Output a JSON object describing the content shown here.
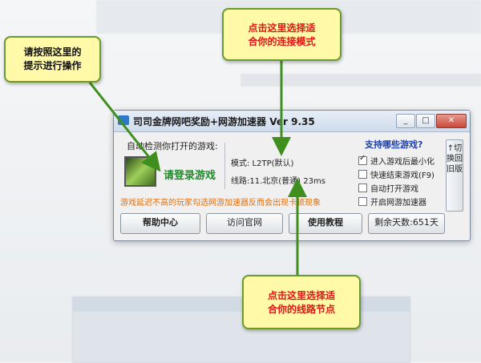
{
  "window": {
    "title": "司司金牌网吧奖励+网游加速器 Ver 9.35",
    "controls": {
      "min": "_",
      "max": "□",
      "close": "✕"
    }
  },
  "main": {
    "auto_detect_label": "自动检测你打开的游戏:",
    "login_link": "请登录游戏",
    "mode_text": "模式: L2TP(默认)",
    "line_text": "线路:11.北京(普通) 23ms",
    "warning": "游戏延迟不高的玩家勾选网游加速器反而会出现卡顿现象"
  },
  "right_panel": {
    "title": "支持哪些游戏?",
    "options": [
      {
        "label": "进入游戏后最小化",
        "checked": true
      },
      {
        "label": "快速结束游戏(F9)",
        "checked": false
      },
      {
        "label": "自动打开游戏",
        "checked": false
      },
      {
        "label": "开启网游加速器",
        "checked": false
      }
    ],
    "switch_label": "↑切换回旧版"
  },
  "buttons": {
    "help": "帮助中心",
    "site": "访问官网",
    "tutorial": "使用教程",
    "days": "剩余天数:651天"
  },
  "annotations": {
    "note1": [
      "请按照这里的",
      "提示进行操作"
    ],
    "note2": [
      "点击这里选择适",
      "合你的连接模式"
    ],
    "note3": [
      "点击这里选择适",
      "合你的线路节点"
    ]
  },
  "colors": {
    "accent_green": "#1f8a2a",
    "warning_orange": "#e07010",
    "note_red": "#e11414",
    "arrow_green": "#3f8f1e"
  }
}
